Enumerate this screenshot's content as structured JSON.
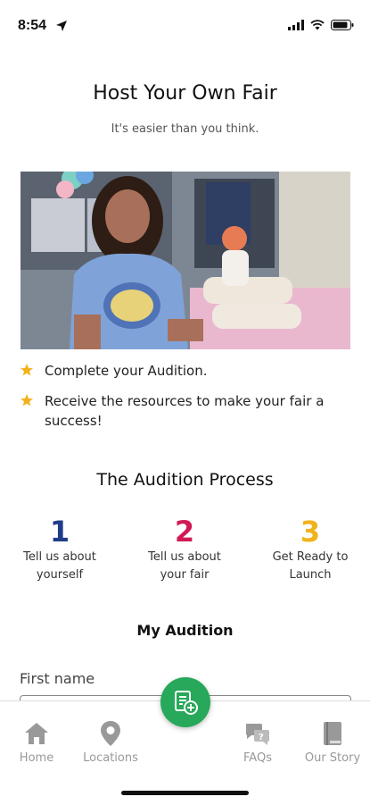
{
  "status": {
    "time": "8:54"
  },
  "header": {
    "title": "Host Your Own Fair",
    "subtitle": "It's easier than you think."
  },
  "hero": {
    "image": "girl-at-childrens-business-fair-photo"
  },
  "bullets": [
    {
      "text": "Complete your Audition."
    },
    {
      "text": "Receive the resources to make your fair a success!"
    }
  ],
  "process": {
    "title": "The Audition Process",
    "steps": [
      {
        "num": "1",
        "label": "Tell us about yourself",
        "color": "#1f3c88"
      },
      {
        "num": "2",
        "label": "Tell us about your fair",
        "color": "#d11a55"
      },
      {
        "num": "3",
        "label": "Get Ready to Launch",
        "color": "#f2b21c"
      }
    ]
  },
  "form": {
    "title": "My Audition",
    "first_name_label": "First name"
  },
  "nav": {
    "items": [
      {
        "label": "Home",
        "icon": "home-icon"
      },
      {
        "label": "Locations",
        "icon": "location-pin-icon"
      },
      {
        "label": "FAQs",
        "icon": "faq-chat-icon"
      },
      {
        "label": "Our Story",
        "icon": "book-icon"
      }
    ],
    "fab_icon": "add-application-icon",
    "accent": "#27a85a"
  }
}
